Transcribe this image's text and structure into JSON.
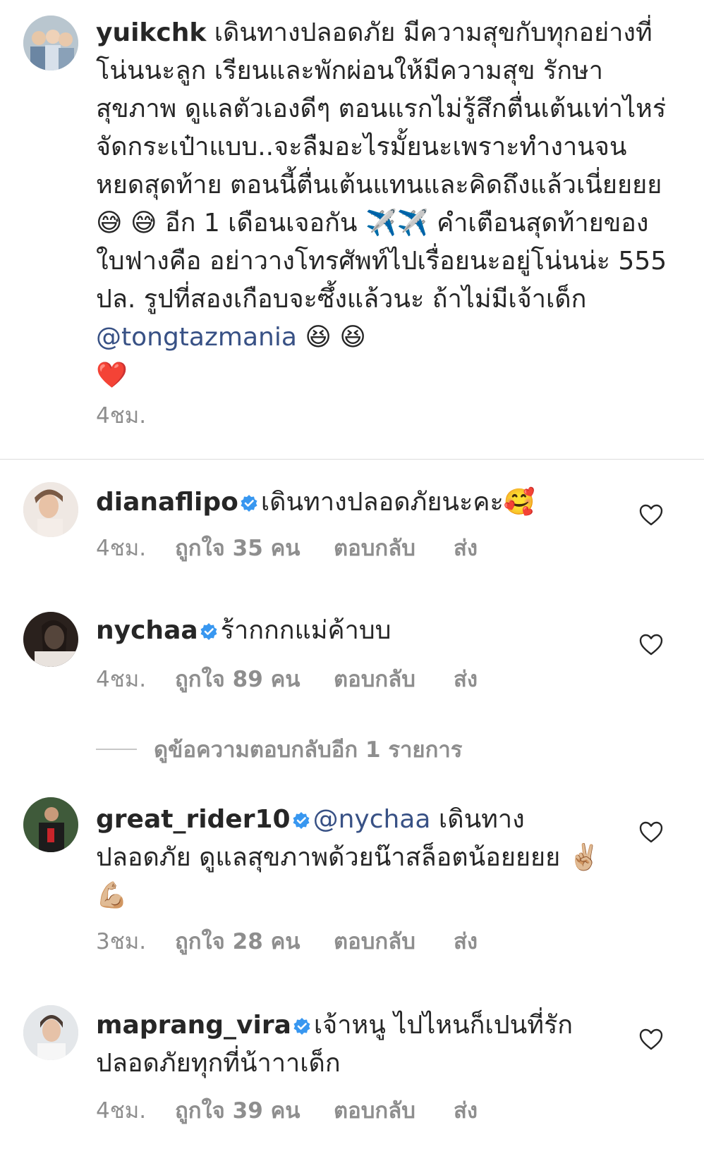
{
  "caption": {
    "username": "yuikchk",
    "text_1": "เดินทางปลอดภัย มีความสุขกับทุกอย่างที่โน่นนะลูก เรียนและพักผ่อนให้มีความสุข รักษาสุขภาพ ดูแลตัวเองดีๆ ตอนแรกไม่รู้สึกตื่นเต้นเท่าไหร่ จัดกระเป๋าแบบ..จะลืมอะไรมั้ยนะเพราะทำงานจนหยดสุดท้าย ตอนนี้ตื่นเต้นแทนและคิดถึงแล้วเนี่ยยยย",
    "emoji_1": "😅 😅",
    "text_2": "อีก 1 เดือนเจอกัน",
    "emoji_2": "✈️✈️",
    "text_3": "คำเตือนสุดท้ายของใบฟางคือ อย่าวางโทรศัพท์ไปเรื่อยนะอยู่โน่นน่ะ 555 ปล. รูปที่สองเกือบจะซึ้งแล้วนะ ถ้าไม่มีเจ้าเด็ก",
    "mention": "@tongtazmania",
    "emoji_3": "😆 😆",
    "emoji_4": "❤️",
    "time": "4ชม."
  },
  "comments": [
    {
      "username": "dianaflipo",
      "text": "เดินทางปลอดภัยนะคะ",
      "emoji": "🥰",
      "time": "4ชม.",
      "likes": "ถูกใจ 35 คน",
      "reply": "ตอบกลับ",
      "send": "ส่ง"
    },
    {
      "username": "nychaa",
      "text": "ร้ากกกแม่ค้าบบ",
      "time": "4ชม.",
      "likes": "ถูกใจ 89 คน",
      "reply": "ตอบกลับ",
      "send": "ส่ง"
    },
    {
      "username": "great_rider10",
      "mention": "@nychaa",
      "text": "เดินทางปลอดภัย ดูแลสุขภาพด้วยน๊าสล็อตน้อยยยย",
      "emoji": "✌🏼 💪🏼",
      "time": "3ชม.",
      "likes": "ถูกใจ 28 คน",
      "reply": "ตอบกลับ",
      "send": "ส่ง"
    },
    {
      "username": "maprang_vira",
      "text": "เจ้าหนู ไปไหนก็เปนที่รักปลอดภัยทุกที่น้าาาเด็ก",
      "time": "4ชม.",
      "likes": "ถูกใจ 39 คน",
      "reply": "ตอบกลับ",
      "send": "ส่ง"
    }
  ],
  "view_replies": "ดูข้อความตอบกลับอีก 1 รายการ",
  "colors": {
    "text": "#262626",
    "meta": "#8e8e8e",
    "mention": "#385185",
    "verified": "#3897f0",
    "divider": "#dbdbdb"
  }
}
